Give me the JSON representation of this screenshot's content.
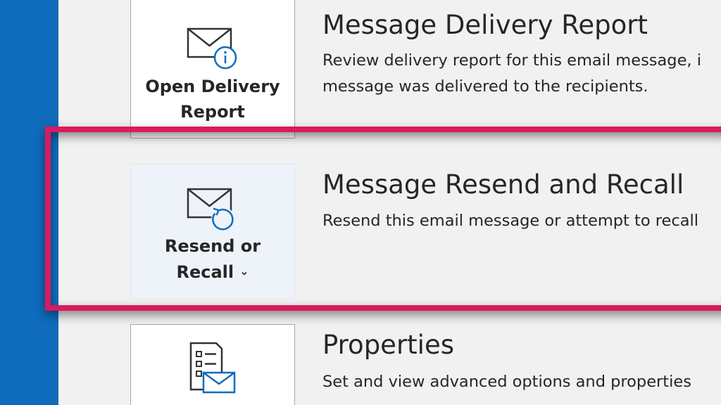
{
  "sections": [
    {
      "button_label_lines": [
        "Open Delivery",
        "Report"
      ],
      "button_icon": "envelope-info-icon",
      "title": "Message Delivery Report",
      "description_lines": [
        "Review delivery report for this email message, i",
        "message was delivered to the recipients."
      ]
    },
    {
      "button_label_lines": [
        "Resend or",
        "Recall"
      ],
      "button_icon": "envelope-refresh-icon",
      "button_dropdown_icon": "chevron-down-icon",
      "title": "Message Resend and Recall",
      "description_lines": [
        "Resend this email message or attempt to recall"
      ]
    },
    {
      "button_icon": "properties-envelope-icon",
      "title": "Properties",
      "description_lines": [
        "Set and view advanced options and properties"
      ]
    }
  ],
  "colors": {
    "sidebar": "#0f6cbd",
    "icon_accent": "#0f6cbd",
    "highlight_border": "#d81b60",
    "background": "#f1f1f1"
  }
}
